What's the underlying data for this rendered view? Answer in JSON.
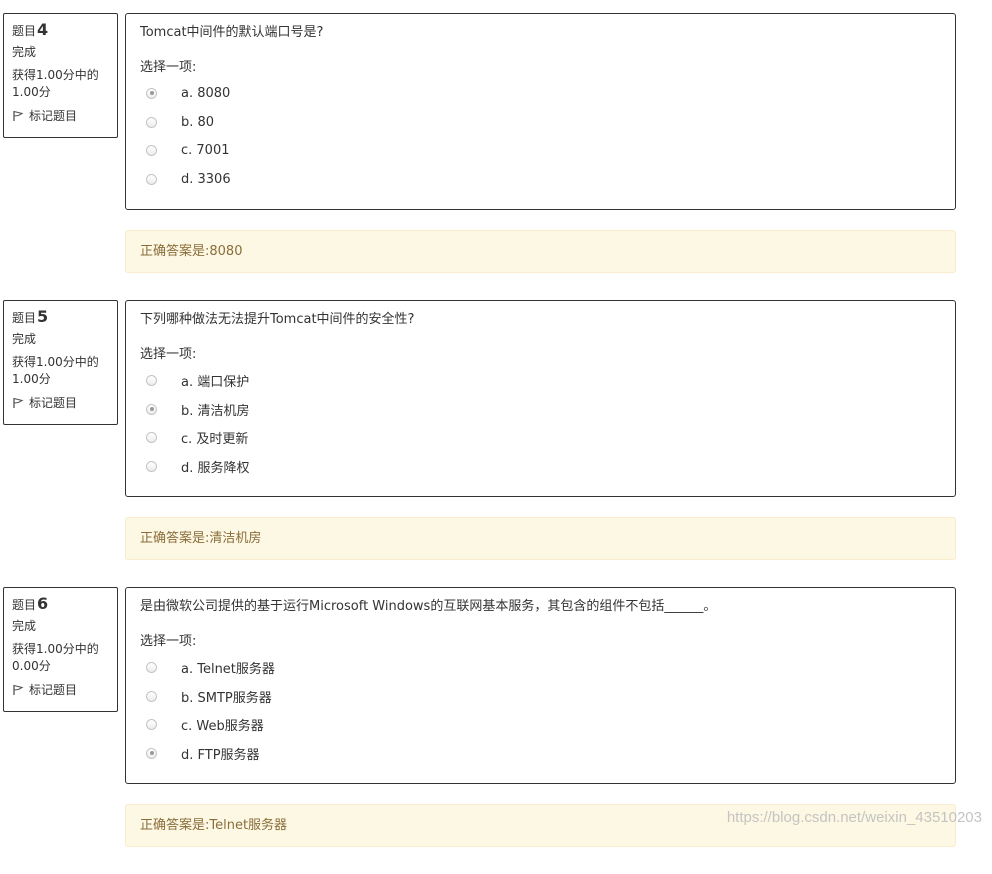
{
  "questions": [
    {
      "label": "题目",
      "number": "4",
      "state": "完成",
      "grade": "获得1.00分中的1.00分",
      "flag_label": "标记题目",
      "text": "Tomcat中间件的默认端口号是?",
      "prompt": "选择一项:",
      "options": [
        {
          "label": "a. 8080",
          "checked": true
        },
        {
          "label": "b. 80",
          "checked": false
        },
        {
          "label": "c. 7001",
          "checked": false
        },
        {
          "label": "d. 3306",
          "checked": false
        }
      ],
      "feedback": "正确答案是:8080"
    },
    {
      "label": "题目",
      "number": "5",
      "state": "完成",
      "grade": "获得1.00分中的1.00分",
      "flag_label": "标记题目",
      "text": "下列哪种做法无法提升Tomcat中间件的安全性?",
      "prompt": "选择一项:",
      "options": [
        {
          "label": "a. 端口保护",
          "checked": false
        },
        {
          "label": "b. 清洁机房",
          "checked": true
        },
        {
          "label": "c. 及时更新",
          "checked": false
        },
        {
          "label": "d. 服务降权",
          "checked": false
        }
      ],
      "feedback": "正确答案是:清洁机房"
    },
    {
      "label": "题目",
      "number": "6",
      "state": "完成",
      "grade": "获得1.00分中的0.00分",
      "flag_label": "标记题目",
      "text": "是由微软公司提供的基于运行Microsoft Windows的互联网基本服务，其包含的组件不包括______。",
      "prompt": "选择一项:",
      "options": [
        {
          "label": "a. Telnet服务器",
          "checked": false
        },
        {
          "label": "b. SMTP服务器",
          "checked": false
        },
        {
          "label": "c. Web服务器",
          "checked": false
        },
        {
          "label": "d. FTP服务器",
          "checked": true
        }
      ],
      "feedback": "正确答案是:Telnet服务器"
    }
  ],
  "watermark": "https://blog.csdn.net/weixin_43510203"
}
